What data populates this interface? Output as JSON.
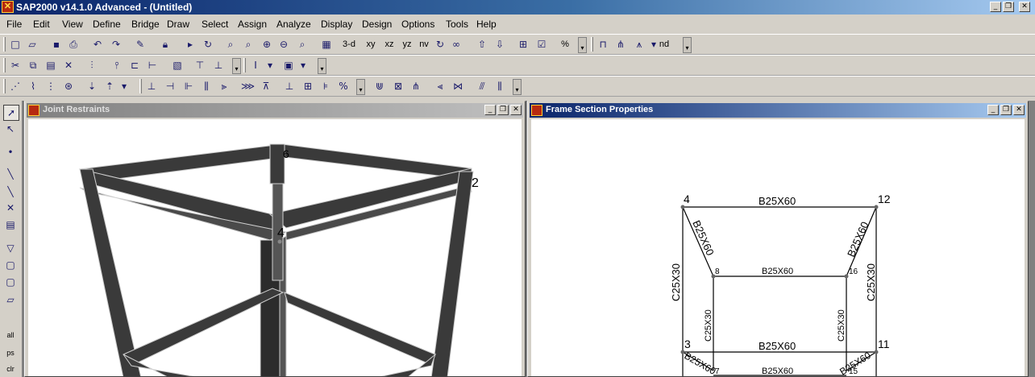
{
  "app": {
    "title": "SAP2000 v14.1.0 Advanced  - (Untitled)"
  },
  "window_controls": {
    "minimize": "_",
    "restore": "❐",
    "close": "✕"
  },
  "menu": [
    "File",
    "Edit",
    "View",
    "Define",
    "Bridge",
    "Draw",
    "Select",
    "Assign",
    "Analyze",
    "Display",
    "Design",
    "Options",
    "Tools",
    "Help"
  ],
  "toolbar": {
    "view_3d": "3-d",
    "view_xy": "xy",
    "view_xz": "xz",
    "view_yz": "yz",
    "view_nv": "nv",
    "fraction": "%",
    "label_nd": "nd",
    "dropdown": "▾"
  },
  "sidebar": {
    "all": "all",
    "ps": "ps",
    "clr": "clr"
  },
  "windows": {
    "left": {
      "title": "Joint Restraints"
    },
    "right": {
      "title": "Frame Section Properties"
    }
  },
  "left_view": {
    "joint_labels": {
      "j6": "6",
      "j12": "2",
      "j4": "4"
    }
  },
  "right_view": {
    "nodes": {
      "n4": "4",
      "n12": "12",
      "n8": "8",
      "n16": "16",
      "n3": "3",
      "n11": "11",
      "n7": "7",
      "n15": "15"
    },
    "sections": {
      "beam_top_outer": "B25X60",
      "beam_top_diag_left": "B25X60",
      "beam_top_diag_right": "B25X60",
      "beam_top_inner": "B25X60",
      "col_outer_left": "C25X30",
      "col_outer_right": "C25X30",
      "col_inner_left": "C25X30",
      "col_inner_right": "C25X30",
      "beam_mid_outer": "B25X60",
      "beam_mid_diag_left": "B25X60",
      "beam_mid_diag_right": "B25X60",
      "beam_bottom_inner": "B25X60"
    }
  },
  "colors": {
    "title_active": "#0a246a",
    "title_inactive": "#808080",
    "face": "#d4d0c8",
    "frame_fill": "#3a3a3a"
  }
}
